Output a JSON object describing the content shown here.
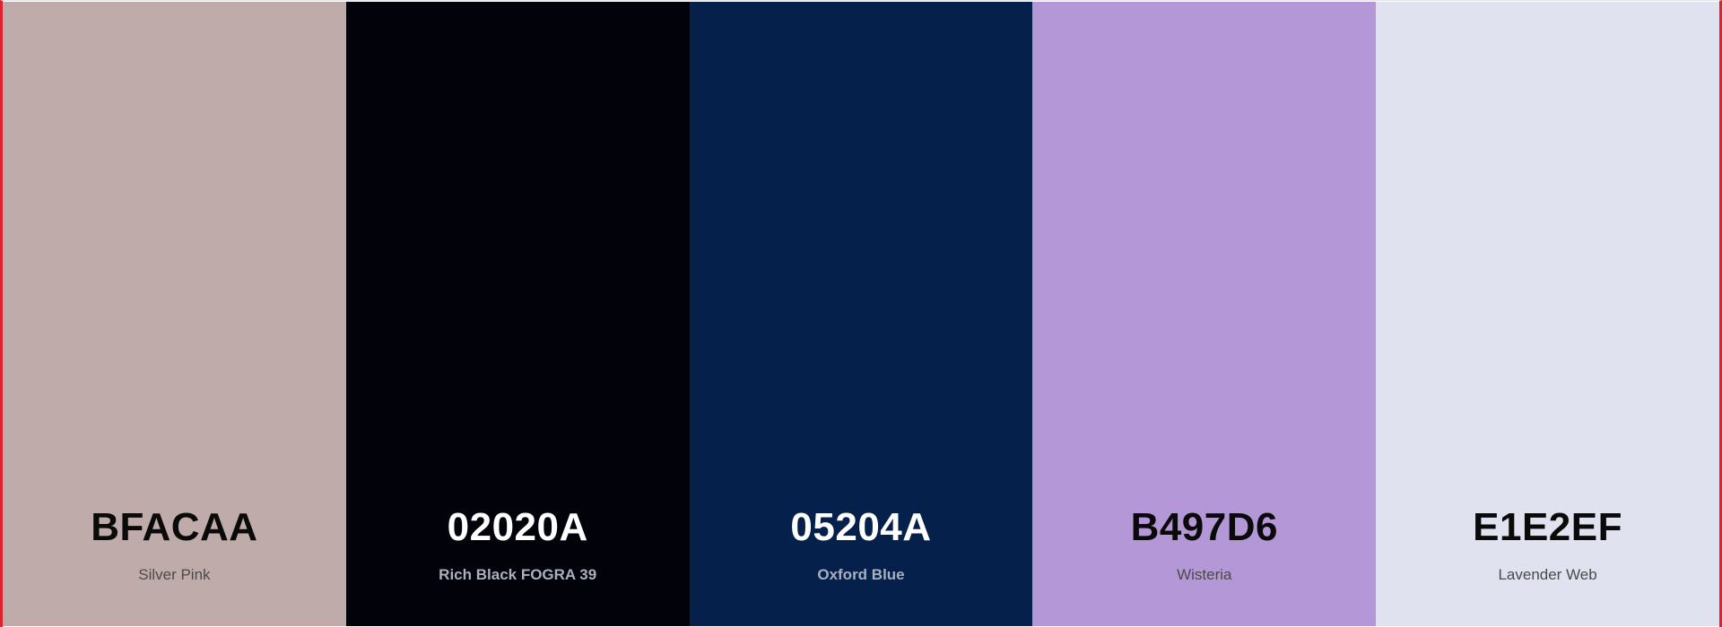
{
  "palette": {
    "colors": [
      {
        "hex": "BFACAA",
        "name": "Silver Pink",
        "color": "#BFACAA",
        "tone": "light"
      },
      {
        "hex": "02020A",
        "name": "Rich Black FOGRA 39",
        "color": "#02020A",
        "tone": "dark"
      },
      {
        "hex": "05204A",
        "name": "Oxford Blue",
        "color": "#05204A",
        "tone": "dark"
      },
      {
        "hex": "B497D6",
        "name": "Wisteria",
        "color": "#B497D6",
        "tone": "light"
      },
      {
        "hex": "E1E2EF",
        "name": "Lavender Web",
        "color": "#E1E2EF",
        "tone": "light"
      }
    ]
  }
}
